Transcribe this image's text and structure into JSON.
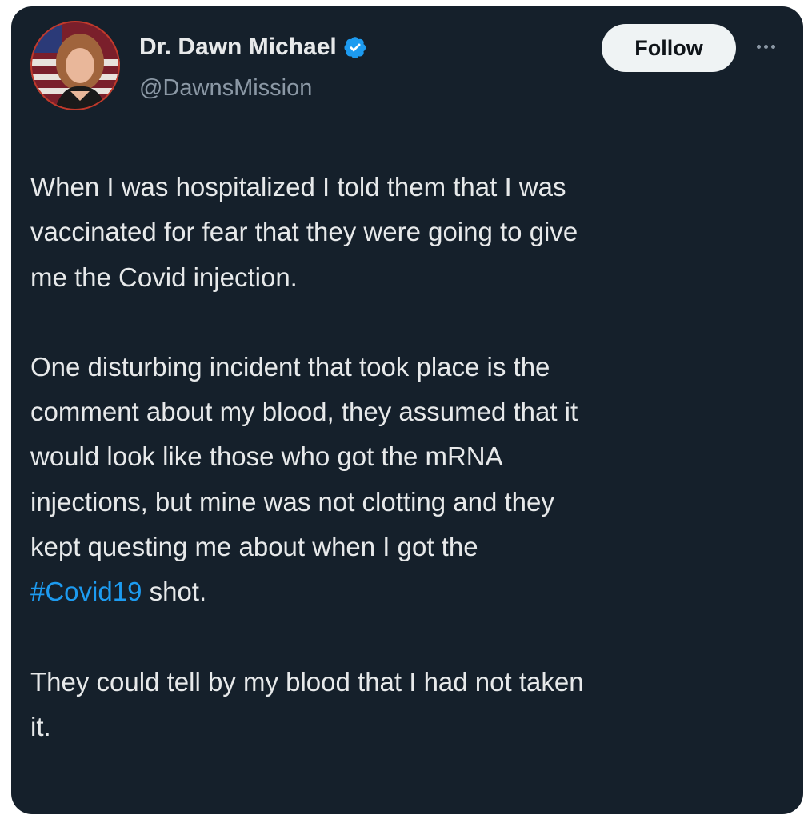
{
  "tweet": {
    "author": {
      "display_name": "Dr. Dawn Michael",
      "handle": "@DawnsMission",
      "verified": true,
      "avatar_icon": "profile-photo"
    },
    "follow_label": "Follow",
    "more_icon": "more-horizontal-icon",
    "paragraphs": [
      {
        "lines": [
          "When I was hospitalized I told them that I was",
          "vaccinated for fear that they were going to give",
          "me the Covid injection."
        ]
      },
      {
        "lines": [
          "One disturbing incident that took place is the",
          "comment about my blood, they assumed that it",
          "would look like those who got the mRNA",
          "injections, but mine was not clotting and they",
          "kept questing me about when I got the"
        ],
        "hashtag": "#Covid19",
        "after_hashtag": " shot."
      },
      {
        "lines": [
          "They could tell by my blood that I had not taken",
          "it."
        ]
      }
    ]
  },
  "colors": {
    "background": "#15202b",
    "text": "#e7e9ea",
    "secondary_text": "#8b98a5",
    "link": "#1d9bf0",
    "follow_button_bg": "#eff3f4",
    "verified_badge": "#1d9bf0"
  }
}
